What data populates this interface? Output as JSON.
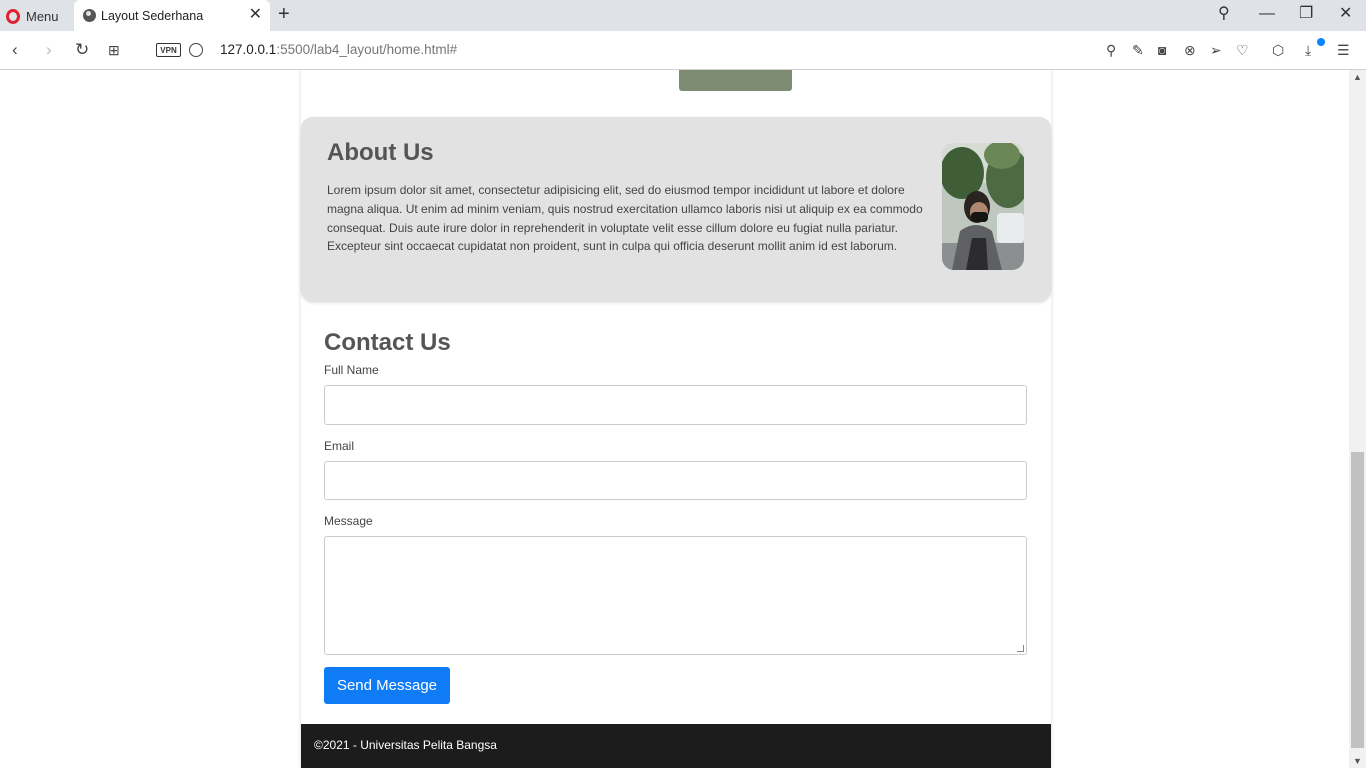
{
  "browser": {
    "menu_label": "Menu",
    "tab_title": "Layout Sederhana",
    "url_host": "127.0.0.1",
    "url_rest": ":5500/lab4_layout/home.html#",
    "vpn_label": "VPN",
    "icons": [
      "back-icon",
      "forward-icon",
      "reload-icon",
      "tabs-grid-icon",
      "search-icon",
      "edit-icon",
      "camera-icon",
      "close-circle-icon",
      "send-icon",
      "heart-icon",
      "cube-icon",
      "download-icon",
      "settings-icon"
    ],
    "accent_color": "#0a84ff"
  },
  "about": {
    "title": "About Us",
    "body": "Lorem ipsum dolor sit amet, consectetur adipisicing elit, sed do eiusmod tempor incididunt ut labore et dolore magna aliqua. Ut enim ad minim veniam, quis nostrud exercitation ullamco laboris nisi ut aliquip ex ea commodo consequat. Duis aute irure dolor in reprehenderit in voluptate velit esse cillum dolore eu fugiat nulla pariatur. Excepteur sint occaecat cupidatat non proident, sunt in culpa qui officia deserunt mollit anim id est laborum."
  },
  "contact": {
    "title": "Contact Us",
    "name_label": "Full Name",
    "name_value": "",
    "email_label": "Email",
    "email_value": "",
    "message_label": "Message",
    "message_value": "",
    "send_label": "Send Message",
    "send_color": "#0f7cf5"
  },
  "footer": {
    "text": "©2021 - Universitas Pelita Bangsa"
  }
}
